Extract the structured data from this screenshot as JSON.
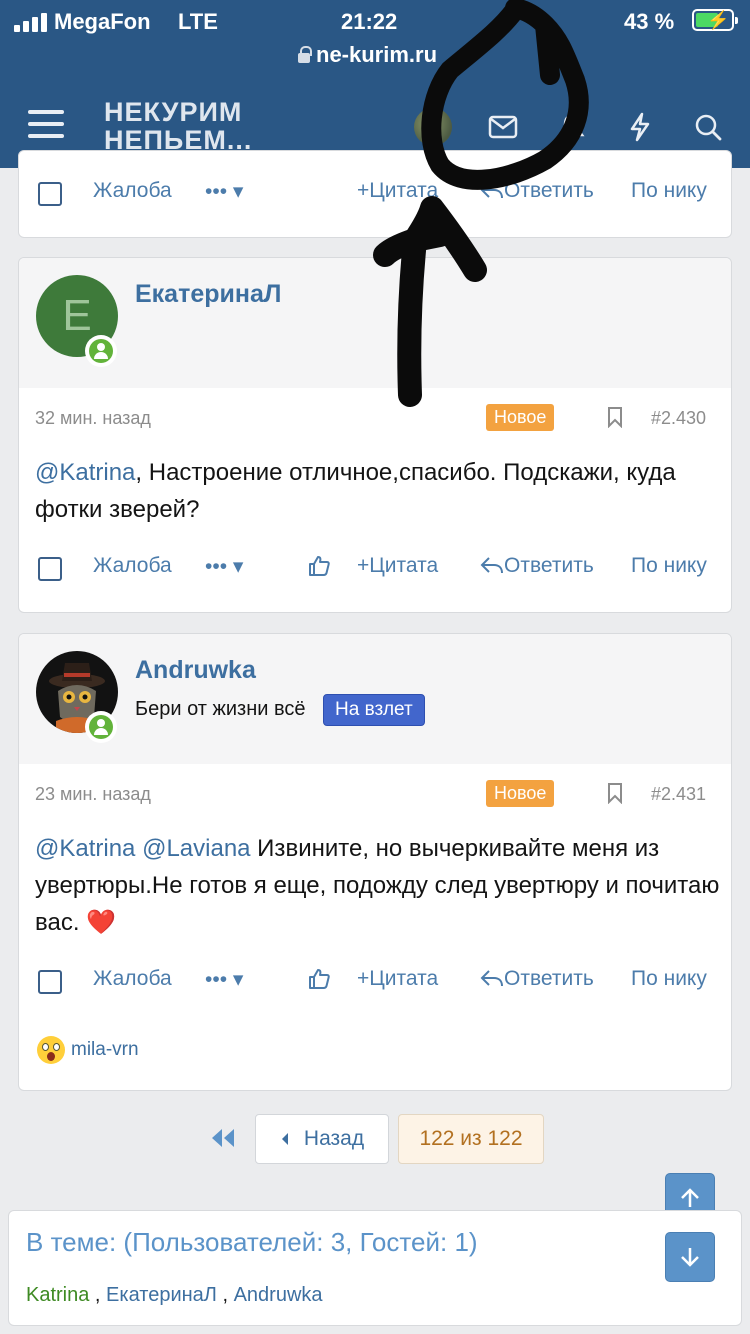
{
  "status": {
    "carrier": "MegaFon",
    "network": "LTE",
    "time": "21:22",
    "battery": "43 %"
  },
  "browser": {
    "url": "ne-kurim.ru"
  },
  "header": {
    "logo_line1": "НЕКУРИМ",
    "logo_line2": "НЕПЬЕМ...",
    "icons": [
      "menu-icon",
      "avatar",
      "mail-icon",
      "bell-icon",
      "lightning-icon",
      "search-icon"
    ]
  },
  "actions_labels": {
    "report": "Жалоба",
    "quote": "Цитата",
    "reply": "Ответить",
    "by_nick": "По нику"
  },
  "posts": [
    {
      "author": "ЕкатеринаЛ",
      "avatar_letter": "E",
      "time": "32 мин. назад",
      "badge": "Новое",
      "number": "#2.430",
      "mention": "@Katrina",
      "text": ", Настроение отличное,спасибо. Подскажи, куда фотки зверей?"
    },
    {
      "author": "Andruwka",
      "user_title": "Бери от жизни всё",
      "rank": "На взлет",
      "time": "23 мин. назад",
      "badge": "Новое",
      "number": "#2.431",
      "mention1": "@Katrina",
      "mention2": "@Laviana",
      "text": " Извините, но вычеркивайте меня из увертюры.Не готов я еще, подожду след увертюру и почитаю вас. ",
      "emoji": "❤️",
      "reaction_user": "mila-vrn"
    }
  ],
  "pagination": {
    "back": "Назад",
    "current": "122 из 122"
  },
  "online": {
    "title": "В теме: (Пользователей: 3, Гостей: 1)",
    "users": [
      "Katrina",
      "ЕкатеринаЛ",
      "Andruwka"
    ],
    "separator": " , "
  },
  "colors": {
    "header": "#2a5785",
    "link": "#3d6fa0",
    "badge": "#f3a240",
    "rank": "#4266cc",
    "online": "#62b33a"
  }
}
